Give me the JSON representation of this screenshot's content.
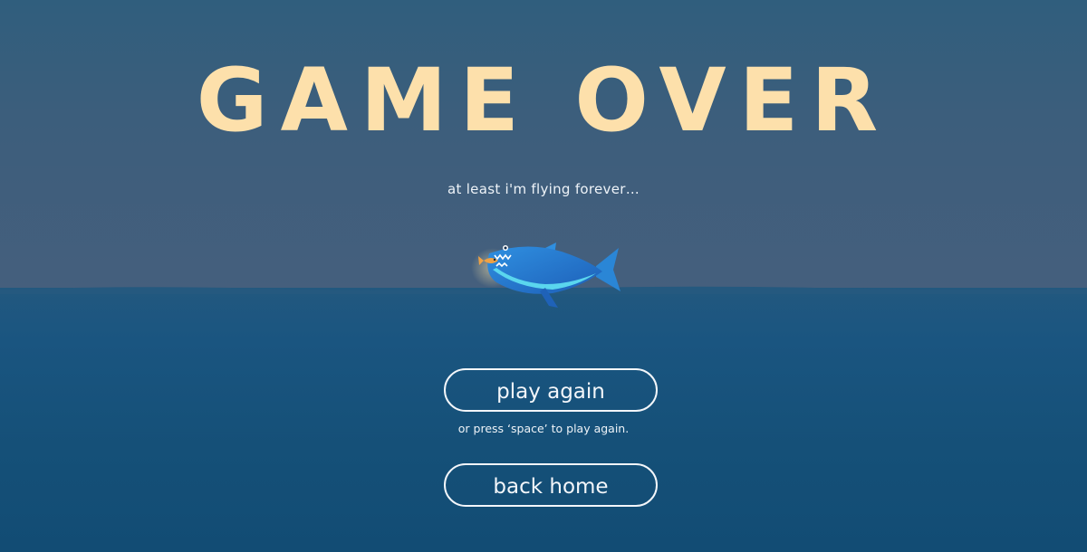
{
  "screen": {
    "title": "GAME OVER",
    "subtitle": "at least i'm flying forever…"
  },
  "buttons": {
    "play_again_label": "play again",
    "play_again_hint": "or press ‘space’ to play again.",
    "back_home_label": "back home"
  },
  "colors": {
    "title": "#fde0ab",
    "text": "#f3f6fa",
    "sky": "#445f7d",
    "sea": "#15507a"
  },
  "icons": {
    "character": "shark-icon",
    "prey": "fish-icon"
  }
}
